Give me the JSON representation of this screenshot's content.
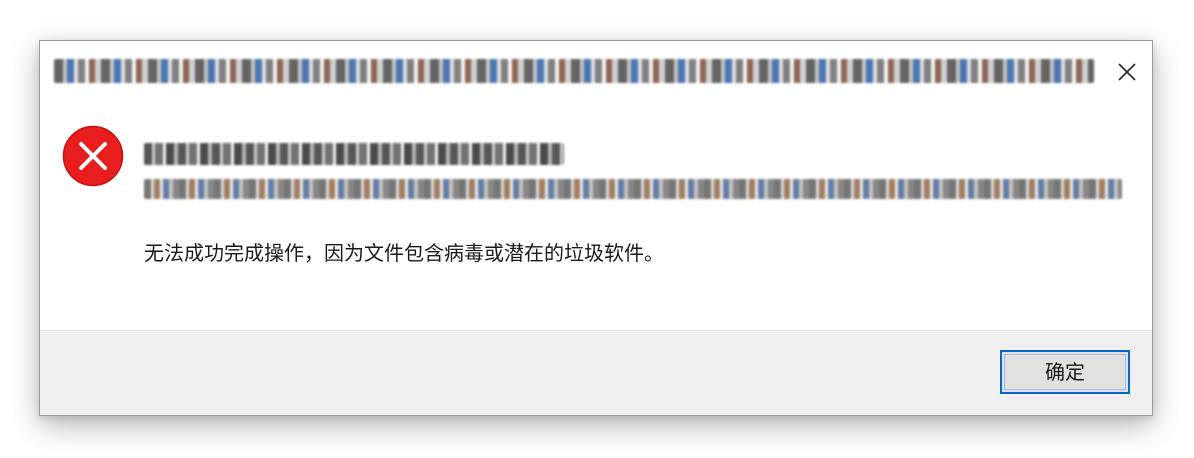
{
  "dialog": {
    "title": "",
    "file_name": "",
    "file_path": "",
    "message": "无法成功完成操作，因为文件包含病毒或潜在的垃圾软件。",
    "ok_label": "确定",
    "icons": {
      "error": "error-circle-x-icon",
      "close": "close-x-icon"
    },
    "colors": {
      "error_red": "#e81d1d",
      "button_border": "#0a67c8",
      "footer_bg": "#f0f0f0"
    }
  }
}
